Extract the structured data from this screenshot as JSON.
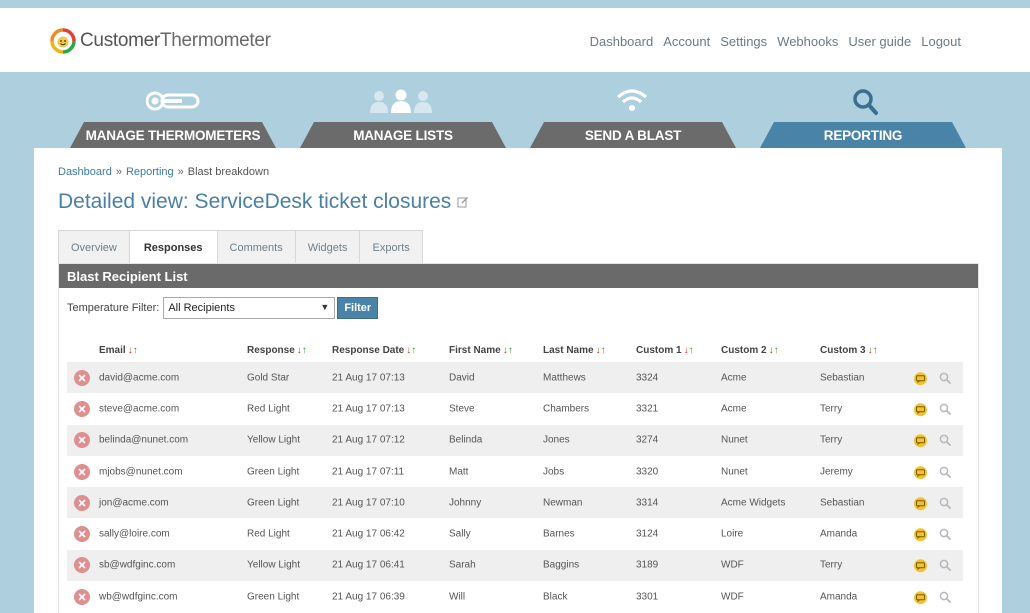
{
  "app": {
    "logo_word1": "Customer",
    "logo_word2": "Thermometer"
  },
  "topnav": [
    "Dashboard",
    "Account",
    "Settings",
    "Webhooks",
    "User guide",
    "Logout"
  ],
  "main_tabs": [
    {
      "label": "MANAGE THERMOMETERS",
      "icon": "thermometer-icon"
    },
    {
      "label": "MANAGE LISTS",
      "icon": "people-icon"
    },
    {
      "label": "SEND A BLAST",
      "icon": "wifi-icon"
    },
    {
      "label": "REPORTING",
      "icon": "search-icon",
      "active": true
    }
  ],
  "breadcrumb": {
    "items": [
      "Dashboard",
      "Reporting"
    ],
    "current": "Blast breakdown",
    "separator": "»"
  },
  "page_title": "Detailed view: ServiceDesk ticket closures",
  "sub_tabs": [
    {
      "label": "Overview"
    },
    {
      "label": "Responses",
      "active": true
    },
    {
      "label": "Comments"
    },
    {
      "label": "Widgets"
    },
    {
      "label": "Exports"
    }
  ],
  "list": {
    "title": "Blast Recipient List",
    "filter_label": "Temperature Filter:",
    "filter_value": "All Recipients",
    "filter_button": "Filter",
    "columns": [
      "Email",
      "Response",
      "Response Date",
      "First Name",
      "Last Name",
      "Custom 1",
      "Custom 2",
      "Custom 3"
    ],
    "rows": [
      {
        "email": "david@acme.com",
        "response": "Gold Star",
        "date": "21 Aug 17 07:13",
        "first": "David",
        "last": "Matthews",
        "c1": "3324",
        "c2": "Acme",
        "c3": "Sebastian"
      },
      {
        "email": "steve@acme.com",
        "response": "Red Light",
        "date": "21 Aug 17 07:13",
        "first": "Steve",
        "last": "Chambers",
        "c1": "3321",
        "c2": "Acme",
        "c3": "Terry"
      },
      {
        "email": "belinda@nunet.com",
        "response": "Yellow Light",
        "date": "21 Aug 17 07:12",
        "first": "Belinda",
        "last": "Jones",
        "c1": "3274",
        "c2": "Nunet",
        "c3": "Terry"
      },
      {
        "email": "mjobs@nunet.com",
        "response": "Green Light",
        "date": "21 Aug 17 07:11",
        "first": "Matt",
        "last": "Jobs",
        "c1": "3320",
        "c2": "Nunet",
        "c3": "Jeremy"
      },
      {
        "email": "jon@acme.com",
        "response": "Green Light",
        "date": "21 Aug 17 07:10",
        "first": "Johnny",
        "last": "Newman",
        "c1": "3314",
        "c2": "Acme Widgets",
        "c3": "Sebastian"
      },
      {
        "email": "sally@loire.com",
        "response": "Red Light",
        "date": "21 Aug 17 06:42",
        "first": "Sally",
        "last": "Barnes",
        "c1": "3124",
        "c2": "Loire",
        "c3": "Amanda"
      },
      {
        "email": "sb@wdfginc.com",
        "response": "Yellow Light",
        "date": "21 Aug 17 06:41",
        "first": "Sarah",
        "last": "Baggins",
        "c1": "3189",
        "c2": "WDF",
        "c3": "Terry"
      },
      {
        "email": "wb@wdfginc.com",
        "response": "Green Light",
        "date": "21 Aug 17 06:39",
        "first": "Will",
        "last": "Black",
        "c1": "3301",
        "c2": "WDF",
        "c3": "Amanda"
      }
    ]
  },
  "colors": {
    "sky": "#aecfde",
    "accent": "#4a83a8",
    "tab_dark": "#6b6b6b",
    "delete": "#e08f8f",
    "comment": "#f2c12e"
  }
}
